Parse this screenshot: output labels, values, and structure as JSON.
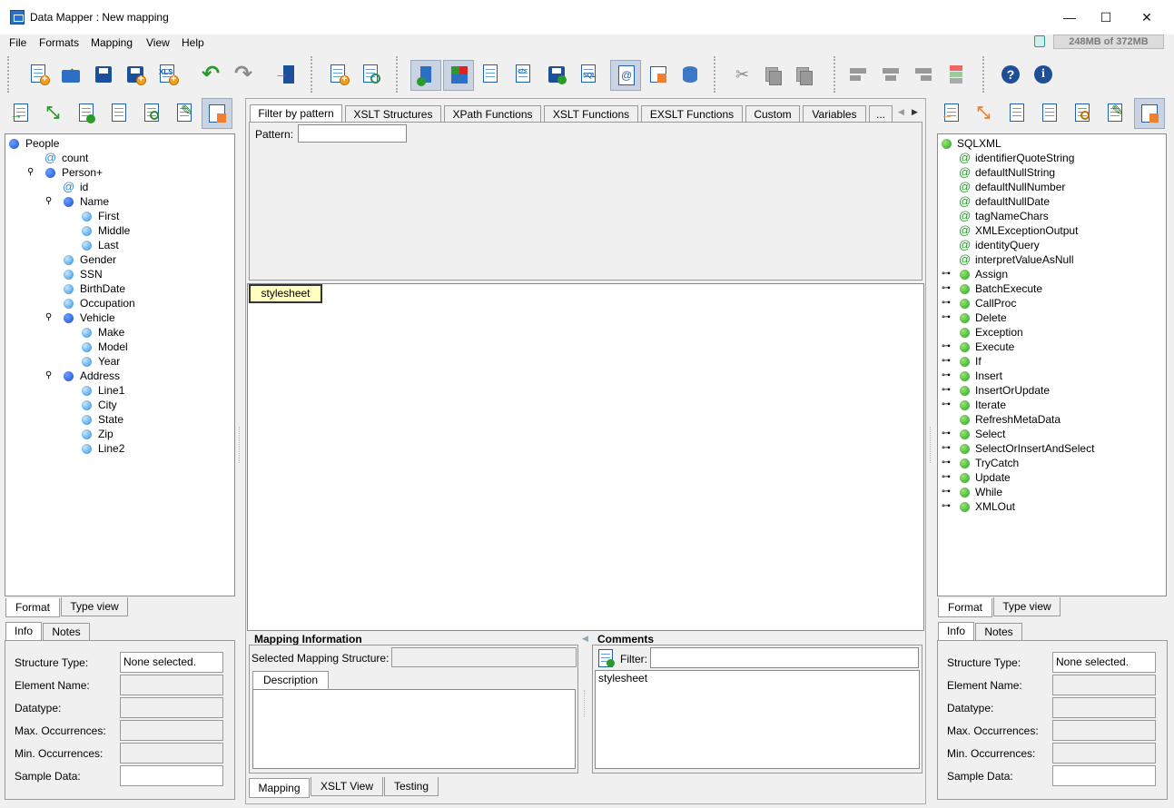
{
  "window": {
    "title": "Data Mapper : New mapping",
    "minimize": "—",
    "maximize": "☐",
    "close": "✕"
  },
  "menu": {
    "items": [
      {
        "label": "File"
      },
      {
        "label": "Formats"
      },
      {
        "label": "Mapping"
      },
      {
        "label": "View"
      },
      {
        "label": "Help"
      }
    ]
  },
  "memory": "248MB of 372MB",
  "toolbar": {
    "icons": [
      "new-mapping-icon",
      "open-icon",
      "save-icon",
      "save-as-icon",
      "export-xls-icon",
      "undo-icon",
      "redo-icon",
      "exit-icon",
      "new-format-icon",
      "format-settings-icon",
      "info-view-icon",
      "color-view-icon",
      "checklist-icon",
      "xml-source-icon",
      "save-format-icon",
      "sql-icon",
      "xml-attr-icon",
      "table-view-icon",
      "database-icon",
      "cut-icon",
      "copy-icon",
      "paste-icon",
      "align-left-icon",
      "align-center-icon",
      "align-right-icon",
      "color-bar-icon",
      "help-icon",
      "about-icon"
    ]
  },
  "left": {
    "tree": [
      {
        "label": "People",
        "kind": "blue"
      },
      {
        "label": "count",
        "kind": "attr"
      },
      {
        "label": "Person+",
        "kind": "blue"
      },
      {
        "label": "id",
        "kind": "attr"
      },
      {
        "label": "Name",
        "kind": "blue"
      },
      {
        "label": "First",
        "kind": "ltblue"
      },
      {
        "label": "Middle",
        "kind": "ltblue"
      },
      {
        "label": "Last",
        "kind": "ltblue"
      },
      {
        "label": "Gender",
        "kind": "ltblue"
      },
      {
        "label": "SSN",
        "kind": "ltblue"
      },
      {
        "label": "BirthDate",
        "kind": "ltblue"
      },
      {
        "label": "Occupation",
        "kind": "ltblue"
      },
      {
        "label": "Vehicle",
        "kind": "blue"
      },
      {
        "label": "Make",
        "kind": "ltblue"
      },
      {
        "label": "Model",
        "kind": "ltblue"
      },
      {
        "label": "Year",
        "kind": "ltblue"
      },
      {
        "label": "Address",
        "kind": "blue"
      },
      {
        "label": "Line1",
        "kind": "ltblue"
      },
      {
        "label": "City",
        "kind": "ltblue"
      },
      {
        "label": "State",
        "kind": "ltblue"
      },
      {
        "label": "Zip",
        "kind": "ltblue"
      },
      {
        "label": "Line2",
        "kind": "ltblue"
      }
    ],
    "tabs": {
      "format": "Format",
      "type_view": "Type view"
    },
    "info_tabs": {
      "info": "Info",
      "notes": "Notes"
    },
    "fields": {
      "structure_type_label": "Structure Type:",
      "structure_type_value": "None selected.",
      "element_name_label": "Element Name:",
      "datatype_label": "Datatype:",
      "max_occ_label": "Max. Occurrences:",
      "min_occ_label": "Min. Occurrences:",
      "sample_data_label": "Sample Data:"
    }
  },
  "center": {
    "tabs": [
      "Filter by pattern",
      "XSLT Structures",
      "XPath Functions",
      "XSLT Functions",
      "EXSLT Functions",
      "Custom",
      "Variables",
      "..."
    ],
    "pattern_label": "Pattern:",
    "pattern_value": "",
    "stylesheet_node": "stylesheet",
    "mapping_info": {
      "title": "Mapping Information",
      "selected_label": "Selected Mapping Structure:",
      "description_tab": "Description"
    },
    "comments": {
      "title": "Comments",
      "filter_label": "Filter:",
      "items": [
        "stylesheet"
      ]
    },
    "bottom_tabs": {
      "mapping": "Mapping",
      "xslt_view": "XSLT View",
      "testing": "Testing"
    }
  },
  "right": {
    "tree": [
      {
        "label": "SQLXML",
        "kind": "root"
      },
      {
        "label": "identifierQuoteString",
        "kind": "attr"
      },
      {
        "label": "defaultNullString",
        "kind": "attr"
      },
      {
        "label": "defaultNullNumber",
        "kind": "attr"
      },
      {
        "label": "defaultNullDate",
        "kind": "attr"
      },
      {
        "label": "tagNameChars",
        "kind": "attr"
      },
      {
        "label": "XMLExceptionOutput",
        "kind": "attr"
      },
      {
        "label": "identityQuery",
        "kind": "attr"
      },
      {
        "label": "interpretValueAsNull",
        "kind": "attr"
      },
      {
        "label": "Assign",
        "kind": "expand"
      },
      {
        "label": "BatchExecute",
        "kind": "expand"
      },
      {
        "label": "CallProc",
        "kind": "expand"
      },
      {
        "label": "Delete",
        "kind": "expand"
      },
      {
        "label": "Exception",
        "kind": "leaf"
      },
      {
        "label": "Execute",
        "kind": "expand"
      },
      {
        "label": "If",
        "kind": "expand"
      },
      {
        "label": "Insert",
        "kind": "expand"
      },
      {
        "label": "InsertOrUpdate",
        "kind": "expand"
      },
      {
        "label": "Iterate",
        "kind": "expand"
      },
      {
        "label": "RefreshMetaData",
        "kind": "leaf"
      },
      {
        "label": "Select",
        "kind": "expand"
      },
      {
        "label": "SelectOrInsertAndSelect",
        "kind": "expand"
      },
      {
        "label": "TryCatch",
        "kind": "expand"
      },
      {
        "label": "Update",
        "kind": "expand"
      },
      {
        "label": "While",
        "kind": "expand"
      },
      {
        "label": "XMLOut",
        "kind": "expand"
      }
    ],
    "tabs": {
      "format": "Format",
      "type_view": "Type view"
    },
    "info_tabs": {
      "info": "Info",
      "notes": "Notes"
    },
    "fields": {
      "structure_type_label": "Structure Type:",
      "structure_type_value": "None selected.",
      "element_name_label": "Element Name:",
      "datatype_label": "Datatype:",
      "max_occ_label": "Max. Occurrences:",
      "min_occ_label": "Min. Occurrences:",
      "sample_data_label": "Sample Data:"
    }
  }
}
